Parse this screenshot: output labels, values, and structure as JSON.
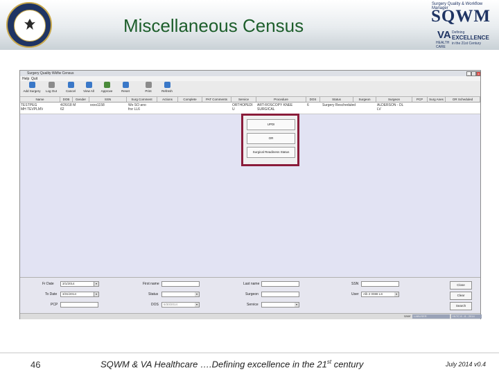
{
  "slide": {
    "title": "Miscellaneous Census",
    "brand": {
      "kicker": "Surgery Quality & Workflow Manager",
      "name": "SQWM"
    },
    "va": {
      "logo": "VA",
      "sub1": "HEALTH",
      "sub2": "CARE",
      "tag1": "Defining",
      "tag2": "EXCELLENCE",
      "tag3": "in the 21st Century"
    },
    "footer": {
      "page": "46",
      "text": "SQWM & VA Healthcare ….Defining excellence in the 21",
      "sup": "st",
      "text_end": " century",
      "date": "July 2014  v0.4"
    }
  },
  "app": {
    "title": "Surgery Quality Wkflw Census",
    "menu": [
      "Help",
      "Quit"
    ],
    "window_controls": [
      "_",
      "□",
      "x"
    ],
    "toolbar": [
      {
        "label": "Add Surgery",
        "icon": "add-surgery-icon",
        "color": "#3a78c8"
      },
      {
        "label": "Log Out",
        "icon": "log-out-icon",
        "color": "#8b8b8b"
      },
      {
        "label": "Cancel",
        "icon": "cancel-icon",
        "color": "#3a78c8"
      },
      {
        "label": "View All",
        "icon": "view-all-icon",
        "color": "#3a78c8"
      },
      {
        "label": "Approve",
        "icon": "approve-icon",
        "color": "#4a8a3a"
      },
      {
        "label": "Reset",
        "icon": "reset-icon",
        "color": "#3a78c8"
      },
      {
        "label": "Print",
        "icon": "print-icon",
        "color": "#8b8b8b"
      },
      {
        "label": "Refresh",
        "icon": "refresh-icon",
        "color": "#3a78c8"
      }
    ],
    "columns": [
      "Name",
      "DOB",
      "Gender",
      "SSN",
      "Surg Comment",
      "Actions",
      "Complete",
      "PAT Comments",
      "Service",
      "Procedure",
      "DOS",
      "Status",
      "Surgeon",
      "Surgeon",
      "PCP",
      "Surg Anes",
      "OR Scheduled"
    ],
    "row": {
      "name": "TESTPEG\nMH TEVPLMV",
      "dob": "4/26/18 M\n62",
      "ssn": "xxxx1158",
      "comment": "Wo SO ano\nfrsr LL6",
      "service": "ORTHOPEDI\nU",
      "procedure": "ART-ROSCOPY KNEE\nSURGICAL",
      "dos": "6",
      "status": "Surgery Rescheduled",
      "surgeon": "ALDERSON - DL\nLV"
    },
    "context_menu": [
      "UPDI",
      "OR",
      "Surgical Readiness Status"
    ],
    "filters": {
      "from_date_label": "Fr Date",
      "from_date_value": "3/1/2014",
      "to_date_label": "To Date",
      "to_date_value": "3/31/2014",
      "pcp_label": "PCP",
      "first_name_label": "First name",
      "status_label": "Status",
      "dos_label": "DOS",
      "dos_value": "6/30/2014",
      "last_name_label": "Last name",
      "surgeon_label": "Surgeon",
      "service_label": "Service",
      "ssn_label": "SSN",
      "user_label": "User",
      "user_value": "Alb 2 0088 LS",
      "buttons": [
        "Close",
        "Clear",
        "Search"
      ]
    },
    "status": {
      "user_label": "User",
      "user_value": "LABUSER",
      "date_value": "HLTC 8 - 8 - 2014"
    }
  }
}
